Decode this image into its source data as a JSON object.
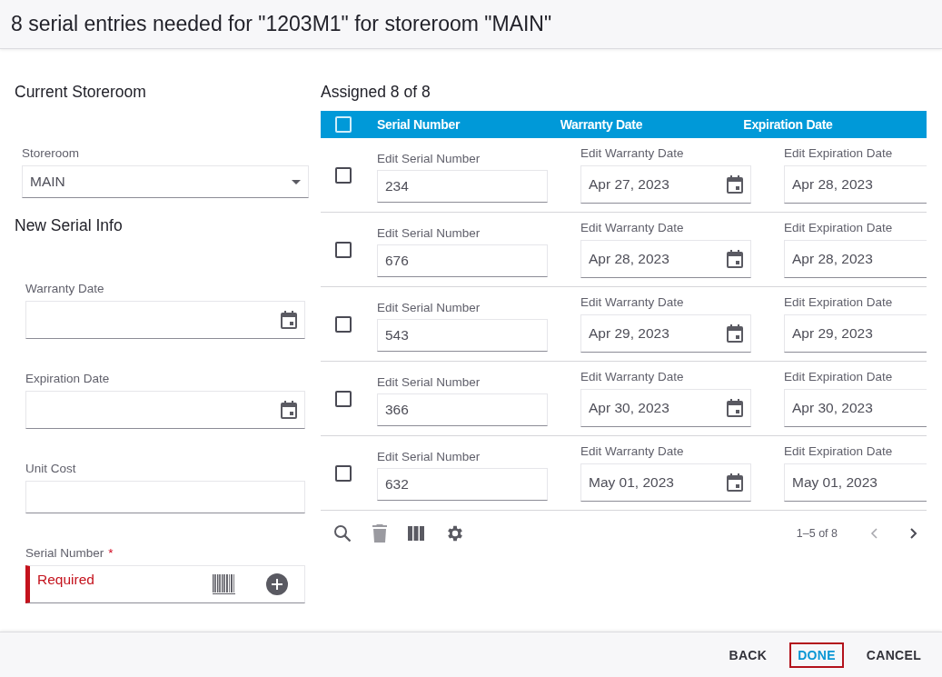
{
  "title": "8 serial entries needed for \"1203M1\" for storeroom \"MAIN\"",
  "left": {
    "sections": [
      {
        "heading": "Current Storeroom",
        "fields": [
          {
            "kind": "select",
            "label": "Storeroom",
            "value": "MAIN"
          }
        ]
      },
      {
        "heading": "New Serial Info",
        "fields": [
          {
            "kind": "date",
            "label": "Warranty Date"
          },
          {
            "kind": "date",
            "label": "Expiration Date"
          },
          {
            "kind": "text",
            "label": "Unit Cost"
          },
          {
            "kind": "serial",
            "label": "Serial Number",
            "required_mark": "*",
            "error": "Required"
          }
        ]
      }
    ]
  },
  "table": {
    "heading": "Assigned 8 of 8",
    "all_checked": false,
    "columns": [
      "Serial Number",
      "Warranty Date",
      "Expiration Date"
    ],
    "rows": [
      {
        "selected": false,
        "cells": [
          {
            "kind": "text",
            "label": "Edit Serial Number",
            "value": "234"
          },
          {
            "kind": "date",
            "label": "Edit Warranty Date",
            "value": "Apr 27, 2023"
          },
          {
            "kind": "cut",
            "label": "Edit Expiration Date",
            "value": "Apr 28, 2023"
          }
        ]
      },
      {
        "selected": false,
        "cells": [
          {
            "kind": "text",
            "label": "Edit Serial Number",
            "value": "676"
          },
          {
            "kind": "date",
            "label": "Edit Warranty Date",
            "value": "Apr 28, 2023"
          },
          {
            "kind": "cut",
            "label": "Edit Expiration Date",
            "value": "Apr 28, 2023"
          }
        ]
      },
      {
        "selected": false,
        "cells": [
          {
            "kind": "text",
            "label": "Edit Serial Number",
            "value": "543"
          },
          {
            "kind": "date",
            "label": "Edit Warranty Date",
            "value": "Apr 29, 2023"
          },
          {
            "kind": "cut",
            "label": "Edit Expiration Date",
            "value": "Apr 29, 2023"
          }
        ]
      },
      {
        "selected": false,
        "cells": [
          {
            "kind": "text",
            "label": "Edit Serial Number",
            "value": "366"
          },
          {
            "kind": "date",
            "label": "Edit Warranty Date",
            "value": "Apr 30, 2023"
          },
          {
            "kind": "cut",
            "label": "Edit Expiration Date",
            "value": "Apr 30, 2023"
          }
        ]
      },
      {
        "selected": false,
        "cells": [
          {
            "kind": "text",
            "label": "Edit Serial Number",
            "value": "632"
          },
          {
            "kind": "date",
            "label": "Edit Warranty Date",
            "value": "May 01, 2023"
          },
          {
            "kind": "cut",
            "label": "Edit Expiration Date",
            "value": "May 01, 2023"
          }
        ]
      }
    ],
    "tools": [
      {
        "kind": "search",
        "disabled": false
      },
      {
        "kind": "delete",
        "disabled": true
      },
      {
        "kind": "columns",
        "disabled": false
      },
      {
        "kind": "settings",
        "disabled": false
      }
    ],
    "pagination": {
      "text": "1–5 of 8",
      "prev_disabled": true,
      "next_disabled": false
    }
  },
  "buttons": [
    {
      "label": "BACK",
      "primary": false,
      "focused": false
    },
    {
      "label": "DONE",
      "primary": true,
      "focused": true
    },
    {
      "label": "CANCEL",
      "primary": false,
      "focused": false
    }
  ]
}
